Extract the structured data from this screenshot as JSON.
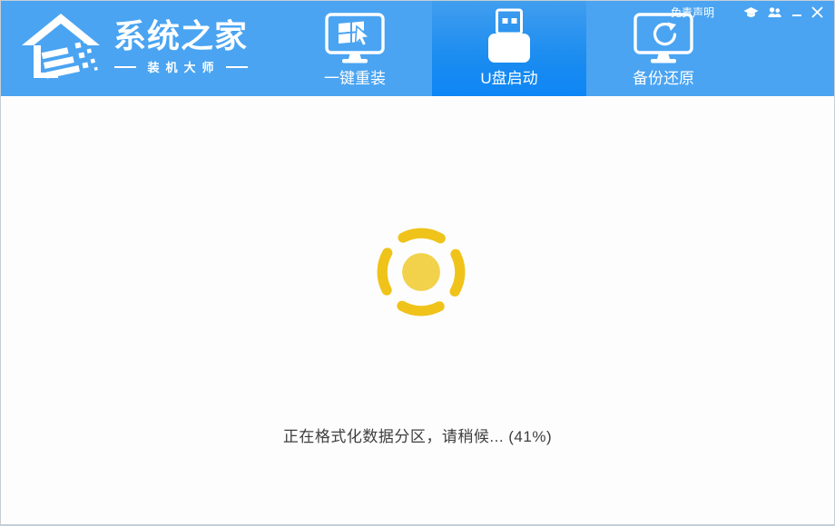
{
  "brand": {
    "name": "系统之家",
    "subtitle": "装机大师"
  },
  "title_bar": {
    "disclaimer_label": "免责声明",
    "icons": [
      "graduation-cap-icon",
      "users-icon",
      "minimize-icon",
      "close-icon"
    ]
  },
  "nav": {
    "tabs": [
      {
        "label": "一键重装",
        "icon": "monitor-windows-cursor-icon",
        "active": false
      },
      {
        "label": "U盘启动",
        "icon": "usb-drive-icon",
        "active": true
      },
      {
        "label": "备份还原",
        "icon": "monitor-restore-icon",
        "active": false
      }
    ]
  },
  "main": {
    "status_text": "正在格式化数据分区，请稍候... (41%)",
    "progress_percent": 41,
    "spinner_icon": "loading-spinner-icon"
  },
  "colors": {
    "header_blue": "#4AA4F2",
    "active_tab_gradient_top": "#419EEF",
    "active_tab_gradient_bottom": "#0E86F6",
    "spinner_ring": "#EFC319",
    "spinner_dot": "#F2D14B",
    "status_text": "#3E3E3E",
    "window_border": "#C6CED5"
  }
}
